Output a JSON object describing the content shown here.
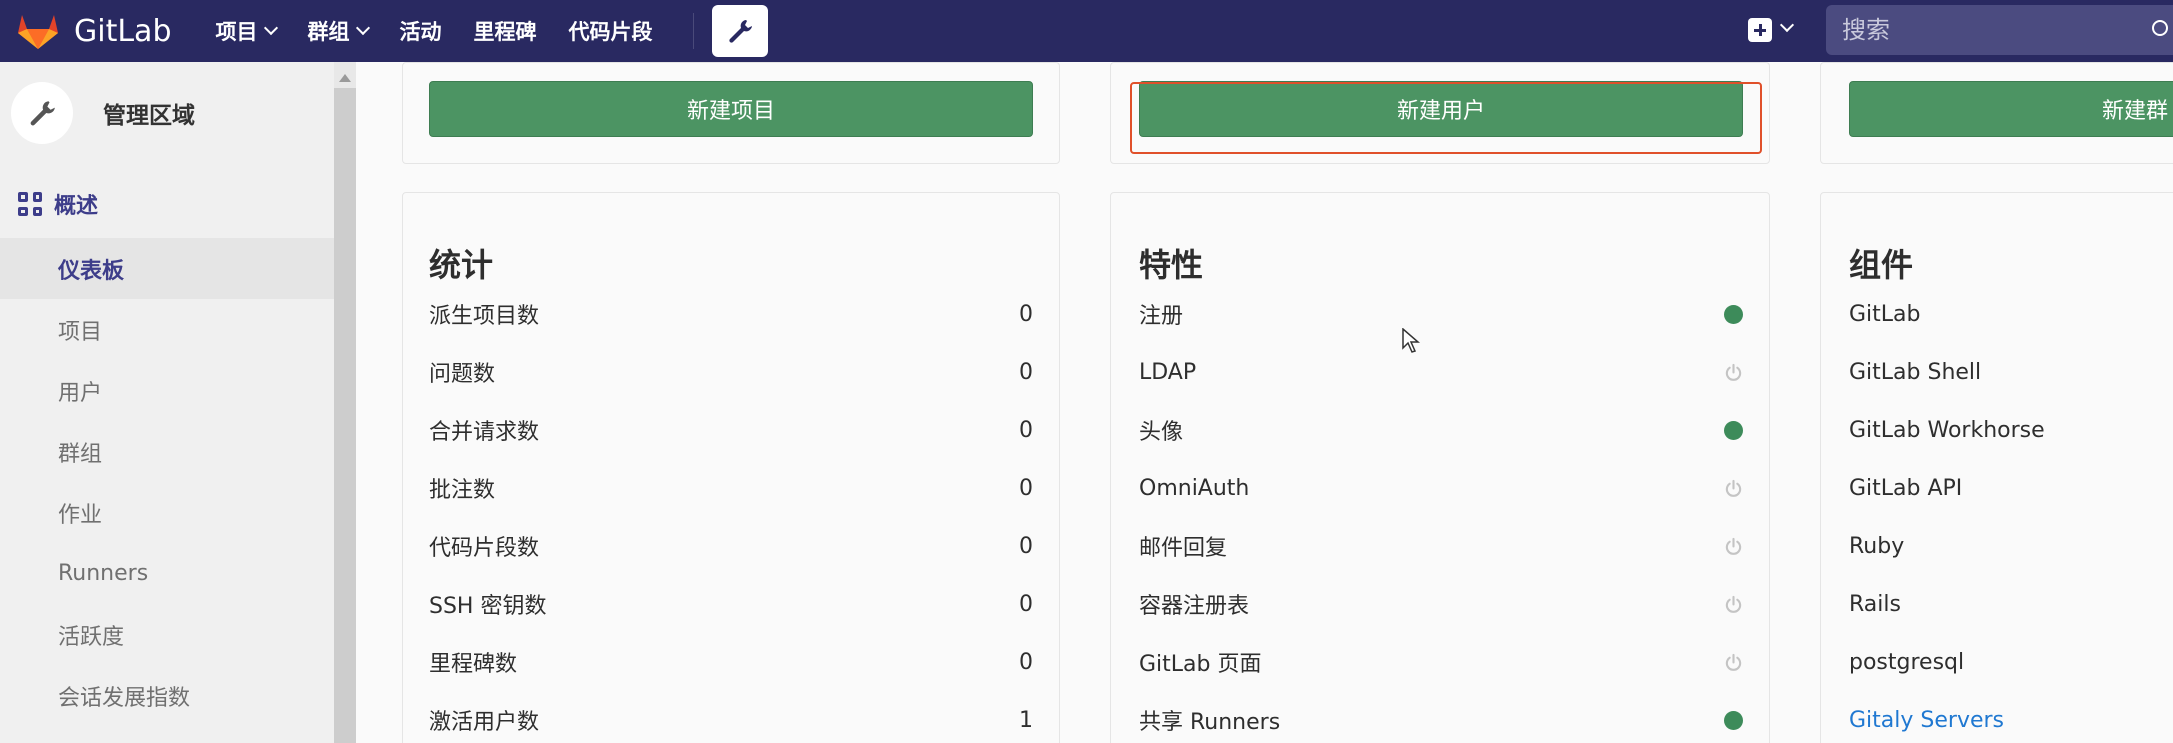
{
  "navbar": {
    "brand": "GitLab",
    "links": [
      {
        "label": "项目",
        "dropdown": true
      },
      {
        "label": "群组",
        "dropdown": true
      },
      {
        "label": "活动",
        "dropdown": false
      },
      {
        "label": "里程碑",
        "dropdown": false
      },
      {
        "label": "代码片段",
        "dropdown": false
      }
    ],
    "search_placeholder": "搜索",
    "colors": {
      "navbar_bg": "#292961"
    }
  },
  "sidebar": {
    "title": "管理区域",
    "overview_label": "概述",
    "items": [
      {
        "label": "仪表板",
        "active": true
      },
      {
        "label": "项目",
        "active": false
      },
      {
        "label": "用户",
        "active": false
      },
      {
        "label": "群组",
        "active": false
      },
      {
        "label": "作业",
        "active": false
      },
      {
        "label": "Runners",
        "active": false
      },
      {
        "label": "活跃度",
        "active": false
      },
      {
        "label": "会话发展指数",
        "active": false
      }
    ]
  },
  "actions": {
    "new_project": "新建项目",
    "new_user": "新建用户",
    "new_group": "新建群"
  },
  "stats": {
    "title": "统计",
    "rows": [
      {
        "label": "派生项目数",
        "value": "0"
      },
      {
        "label": "问题数",
        "value": "0"
      },
      {
        "label": "合并请求数",
        "value": "0"
      },
      {
        "label": "批注数",
        "value": "0"
      },
      {
        "label": "代码片段数",
        "value": "0"
      },
      {
        "label": "SSH 密钥数",
        "value": "0"
      },
      {
        "label": "里程碑数",
        "value": "0"
      },
      {
        "label": "激活用户数",
        "value": "1"
      }
    ]
  },
  "features": {
    "title": "特性",
    "rows": [
      {
        "label": "注册",
        "enabled": true
      },
      {
        "label": "LDAP",
        "enabled": false
      },
      {
        "label": "头像",
        "enabled": true
      },
      {
        "label": "OmniAuth",
        "enabled": false
      },
      {
        "label": "邮件回复",
        "enabled": false
      },
      {
        "label": "容器注册表",
        "enabled": false
      },
      {
        "label": "GitLab 页面",
        "enabled": false
      },
      {
        "label": "共享 Runners",
        "enabled": true
      }
    ],
    "colors": {
      "enabled": "#3d8b5a",
      "disabled": "#c4c4c4"
    }
  },
  "components": {
    "title": "组件",
    "rows": [
      {
        "label": "GitLab",
        "link": false
      },
      {
        "label": "GitLab Shell",
        "link": false
      },
      {
        "label": "GitLab Workhorse",
        "link": false
      },
      {
        "label": "GitLab API",
        "link": false
      },
      {
        "label": "Ruby",
        "link": false
      },
      {
        "label": "Rails",
        "link": false
      },
      {
        "label": "postgresql",
        "link": false
      },
      {
        "label": "Gitaly Servers",
        "link": true
      }
    ]
  }
}
